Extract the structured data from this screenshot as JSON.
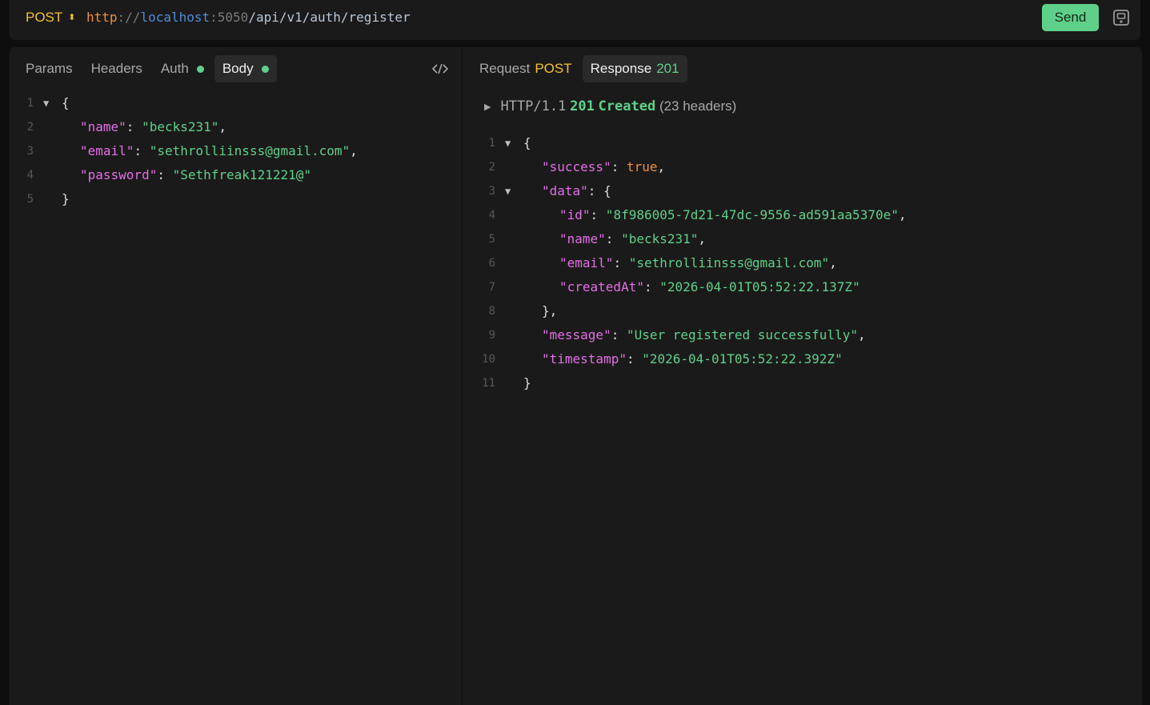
{
  "request_bar": {
    "method": "POST",
    "url_scheme": "http",
    "url_sep": "://",
    "url_host": "localhost",
    "url_port": ":5050",
    "url_path": "/api/v1/auth/register",
    "send_label": "Send"
  },
  "left_panel": {
    "tabs": [
      {
        "label": "Params"
      },
      {
        "label": "Headers"
      },
      {
        "label": "Auth"
      },
      {
        "label": "Body"
      }
    ],
    "body_json": {
      "name": "becks231",
      "email": "sethrolliinsss@gmail.com",
      "password": "Sethfreak121221@"
    }
  },
  "right_panel": {
    "tabs": [
      {
        "label": "Request",
        "accent": "POST"
      },
      {
        "label": "Response",
        "accent": "201"
      }
    ],
    "status": {
      "protocol": "HTTP/1.1",
      "code": "201",
      "text": "Created",
      "headers_count": "(23 headers)"
    },
    "response_json": {
      "success": "true",
      "id": "8f986005-7d21-47dc-9556-ad591aa5370e",
      "name": "becks231",
      "email": "sethrolliinsss@gmail.com",
      "createdAt": "2026-04-01T05:52:22.137Z",
      "message": "User registered successfully",
      "timestamp": "2026-04-01T05:52:22.392Z"
    }
  },
  "colors": {
    "accent_green": "#5fd08a",
    "method_yellow": "#f1c232",
    "json_key": "#e170e6",
    "json_string": "#5fd08a",
    "json_bool": "#f08f3e"
  }
}
